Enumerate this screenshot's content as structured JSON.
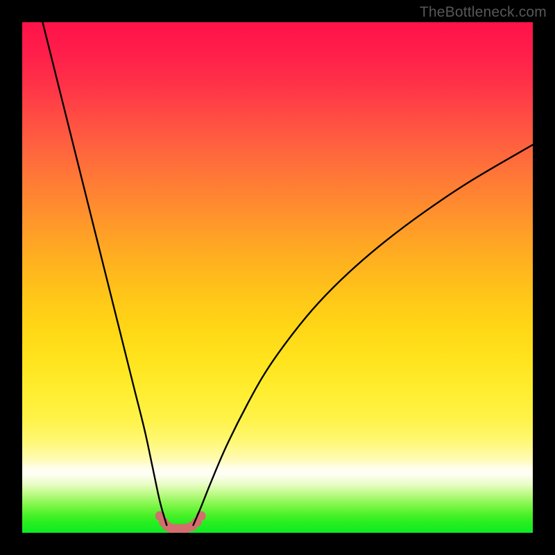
{
  "watermark": "TheBottleneck.com",
  "chart_data": {
    "type": "line",
    "title": "",
    "xlabel": "",
    "ylabel": "",
    "xlim": [
      0,
      100
    ],
    "ylim": [
      0,
      100
    ],
    "grid": false,
    "legend": false,
    "background_gradient": {
      "direction": "vertical",
      "stops": [
        {
          "pos": 0,
          "color": "#ff1249"
        },
        {
          "pos": 0.5,
          "color": "#ffb51e"
        },
        {
          "pos": 0.85,
          "color": "#fffbb2"
        },
        {
          "pos": 0.88,
          "color": "#fffef5"
        },
        {
          "pos": 1.0,
          "color": "#0cec23"
        }
      ]
    },
    "series": [
      {
        "name": "curve-left",
        "x": [
          4,
          6,
          8,
          10,
          12,
          14,
          16,
          18,
          20,
          22,
          24,
          25.5,
          27,
          28.3
        ],
        "y": [
          100,
          92,
          84,
          76,
          68,
          60,
          52,
          44,
          36,
          28,
          20,
          13,
          6,
          1.5
        ]
      },
      {
        "name": "curve-right",
        "x": [
          33.5,
          35,
          37,
          40,
          44,
          48,
          53,
          58,
          64,
          71,
          79,
          88,
          100
        ],
        "y": [
          1.5,
          5,
          10,
          17,
          25,
          32,
          39,
          45,
          51,
          57,
          63,
          69,
          76
        ]
      },
      {
        "name": "bottom-bump",
        "x": [
          27,
          27.7,
          28.4,
          29.2,
          30.1,
          31.1,
          32.2,
          33.3,
          34.2,
          35
        ],
        "y": [
          3.3,
          2.1,
          1.3,
          0.9,
          0.8,
          0.8,
          0.9,
          1.3,
          2.1,
          3.3
        ]
      }
    ],
    "markers": [
      {
        "x": 27.0,
        "y": 3.3
      },
      {
        "x": 27.7,
        "y": 2.1
      },
      {
        "x": 28.4,
        "y": 1.3
      },
      {
        "x": 29.2,
        "y": 0.9
      },
      {
        "x": 30.1,
        "y": 0.8
      },
      {
        "x": 31.1,
        "y": 0.8
      },
      {
        "x": 32.2,
        "y": 0.9
      },
      {
        "x": 33.3,
        "y": 1.3
      },
      {
        "x": 34.2,
        "y": 2.1
      },
      {
        "x": 35.0,
        "y": 3.3
      }
    ],
    "styles": {
      "curve_stroke": "#000000",
      "curve_width": 2.4,
      "bump_stroke": "#d87a7a",
      "bump_width": 9,
      "marker_fill": "#d26e6e",
      "marker_radius": 7
    }
  }
}
